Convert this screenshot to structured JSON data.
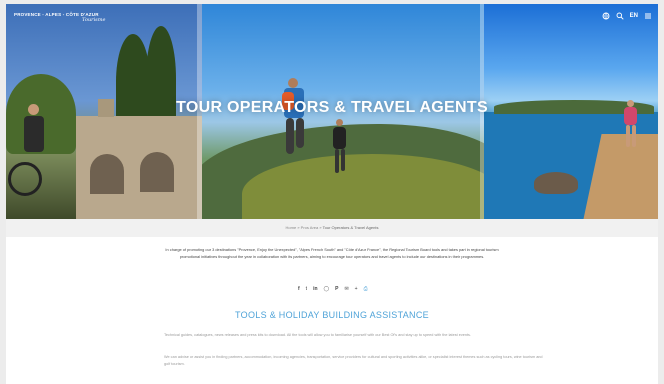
{
  "header": {
    "logo_text": "PROVENCE - ALPES - CÔTE D'AZUR",
    "logo_script": "Tourisme",
    "lang": "EN",
    "icons": [
      "globe-icon",
      "search-icon",
      "menu-icon"
    ]
  },
  "hero": {
    "title": "TOUR OPERATORS & TRAVEL AGENTS"
  },
  "breadcrumb": {
    "home": "Home",
    "section": "Pros Area",
    "current": "Tour Operators & Travel Agents",
    "separator": "»"
  },
  "intro": {
    "text": "In charge of promoting our 3 destinations \"Provence, Enjoy the Unexpected\", \"Alpes French South\" and \"Côte d'Azur France\", the Regional Tourism Board tools and takes part in regional tourism promotional initiatives throughout the year in collaboration with its partners, aiming to encourage tour operators and travel agents to include our destinations in their programmes."
  },
  "share": {
    "icons": [
      "facebook-icon",
      "twitter-icon",
      "linkedin-icon",
      "whatsapp-icon",
      "pinterest-icon",
      "email-icon",
      "plus-icon",
      "print-icon"
    ],
    "glyphs": [
      "f",
      "t",
      "in",
      "◯",
      "P",
      "✉",
      "+",
      "⎙"
    ]
  },
  "section": {
    "title": "TOOLS & HOLIDAY BUILDING ASSISTANCE",
    "para1": "Technical guides, catalogues, news releases and press kits to download. All the tools will allow you to familiarise yourself with our Best Of's and stay up to speed with the latest events.",
    "para2": "We can advise or assist you in finding partners, accommodation, incoming agencies, transportation, service providers for cultural and sporting activities alike, or specialist interest themes such as cycling tours, wine tourism and golf tourism."
  },
  "colors": {
    "accent": "#4fa3d8",
    "text": "#444444",
    "muted": "#9a9a9a"
  }
}
